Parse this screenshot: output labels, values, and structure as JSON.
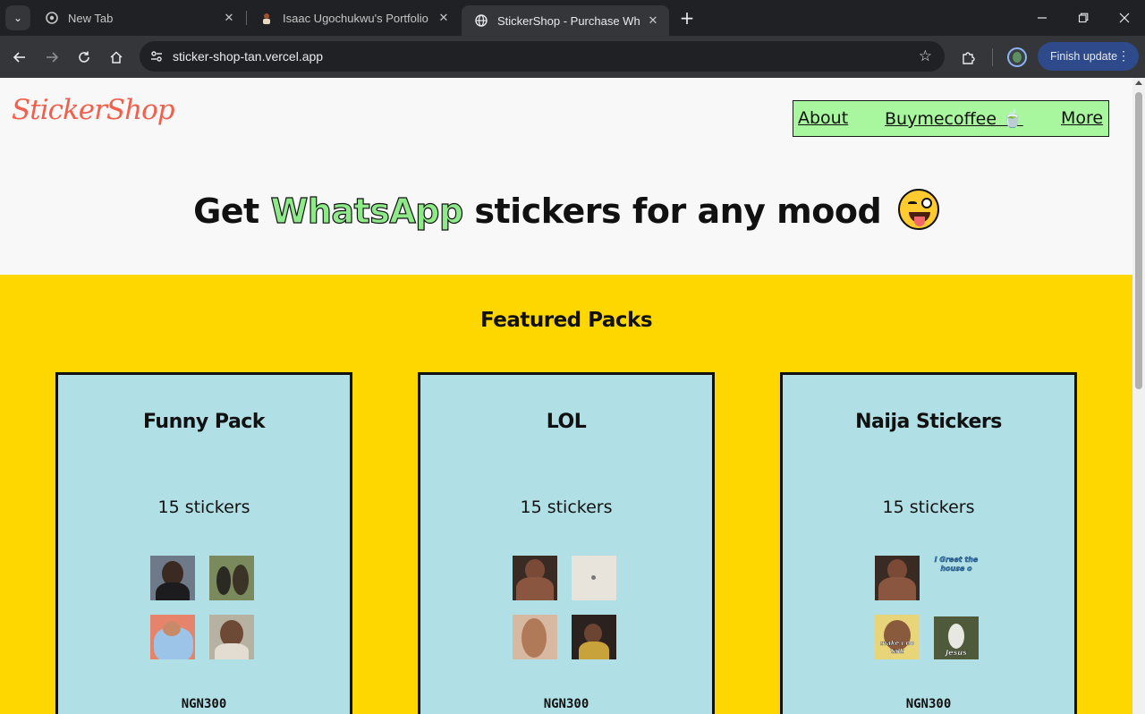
{
  "browser": {
    "tabs": [
      {
        "title": "New Tab",
        "icon": "chrome-icon"
      },
      {
        "title": "Isaac Ugochukwu's Portfolio - F",
        "icon": "portfolio-favicon"
      },
      {
        "title": "StickerShop - Purchase WhatsA",
        "icon": "globe-icon",
        "active": true
      }
    ],
    "url": "sticker-shop-tan.vercel.app",
    "finish_update_label": "Finish update",
    "window_controls": [
      "minimize-icon",
      "restore-icon",
      "close-icon"
    ]
  },
  "site": {
    "logo": "StickerShop",
    "nav": {
      "about": "About",
      "buymecoffee": "Buymecoffee 🍵",
      "more": "More"
    },
    "hero": {
      "part1": "Get ",
      "highlight": "WhatsApp",
      "part2": " stickers for any mood"
    },
    "featured": {
      "title": "Featured Packs",
      "cards": [
        {
          "name": "Funny Pack",
          "count": "15 stickers",
          "price": "NGN300"
        },
        {
          "name": "LOL",
          "count": "15 stickers",
          "price": "NGN300"
        },
        {
          "name": "Naija Stickers",
          "count": "15 stickers",
          "price": "NGN300"
        }
      ]
    },
    "sticker_captions": {
      "greet": "I Greet the house o",
      "make_i_no_talk": "make i no talk",
      "jesus": "Jesus"
    }
  },
  "colors": {
    "featured_bg": "#ffd700",
    "card_bg": "#b0e0e6",
    "nav_bg": "#a8f79e",
    "logo": "#f0604c",
    "whatsapp_highlight": "#8ee989"
  }
}
